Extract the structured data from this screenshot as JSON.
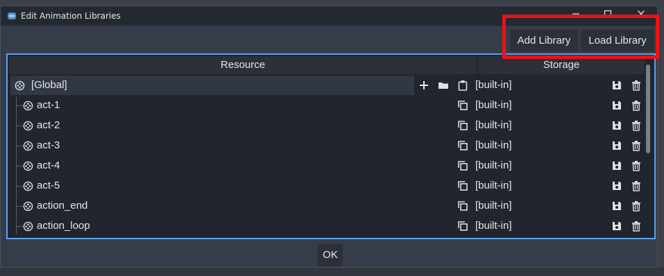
{
  "window": {
    "title": "Edit Animation Libraries",
    "controls": [
      "minimize",
      "maximize",
      "close"
    ]
  },
  "toolbar": {
    "add_library": "Add Library",
    "load_library": "Load Library"
  },
  "table": {
    "headers": {
      "resource": "Resource",
      "storage": "Storage"
    },
    "global_row": {
      "label": "[Global]",
      "storage": "[built-in]"
    },
    "rows": [
      {
        "label": "act-1",
        "storage": "[built-in]"
      },
      {
        "label": "act-2",
        "storage": "[built-in]"
      },
      {
        "label": "act-3",
        "storage": "[built-in]"
      },
      {
        "label": "act-4",
        "storage": "[built-in]"
      },
      {
        "label": "act-5",
        "storage": "[built-in]"
      },
      {
        "label": "action_end",
        "storage": "[built-in]"
      },
      {
        "label": "action_loop",
        "storage": "[built-in]"
      }
    ]
  },
  "footer": {
    "ok": "OK"
  },
  "colors": {
    "accent_border": "#5ea3ee",
    "highlight": "#ee1111",
    "dialog_bg": "#363d4a",
    "tree_bg": "#20252e"
  },
  "icons": {
    "animation": "film-reel-icon",
    "add": "plus-icon",
    "load": "folder-icon",
    "paste": "clipboard-icon",
    "duplicate": "copy-icon",
    "save": "floppy-disk-icon",
    "remove": "trash-icon"
  }
}
